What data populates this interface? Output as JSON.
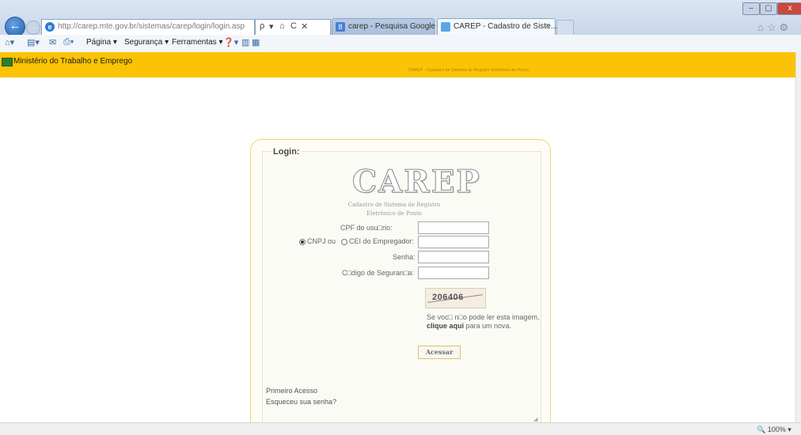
{
  "browser": {
    "address_url": "http://carep.mte.gov.br/sistemas/carep/login/login.asp",
    "address_tools": [
      "ρ",
      "▾",
      "⌂",
      "C",
      "✕"
    ],
    "tabs": [
      {
        "label": "carep - Pesquisa Google",
        "active": false
      },
      {
        "label": "CAREP - Cadastro de Siste...",
        "active": true
      }
    ],
    "close_tab_glyph": "×",
    "window_controls": {
      "minimize": "–",
      "maximize": "▢",
      "close": "x"
    },
    "right_icons": "⌂☆⚙",
    "command_bar": {
      "icons": [
        "home-icon",
        "feeds-icon",
        "mail-icon",
        "print-icon",
        "help-icon",
        "research-icon"
      ],
      "items": [
        "Página ▾",
        "Segurança ▾",
        "Ferramentas ▾"
      ]
    },
    "zoom": "100%"
  },
  "header": {
    "ministry": "Ministério do Trabalho e Emprego",
    "system_name": "CAREP - Cadastro de Sistema de Registro Eletrônico de Ponto"
  },
  "login": {
    "title": "Login:",
    "logo_text": "CAREP",
    "logo_subtitle_1": "Cadastro de Sistema de Registro",
    "logo_subtitle_2": "Eletrônico de Ponto",
    "fields": {
      "cpf_label": "CPF do usu□rio:",
      "radio_cnpj_label": "CNPJ ou",
      "radio_cei_label": "CEI do Empregador:",
      "senha_label": "Senha:",
      "codigo_label": "C□digo de Seguran□a:"
    },
    "captcha_code": "206406",
    "captcha_help_1": "Se voc□ n□o pode ler esta imagem,",
    "captcha_help_link": "clique aqui",
    "captcha_help_2": " para um nova.",
    "submit_label": "Acessar",
    "first_access_link": "Primeiro Acesso",
    "forgot_link": "Esqueceu sua senha?"
  },
  "colors": {
    "header_yellow": "#fbc305",
    "login_border": "#f2d37e"
  }
}
